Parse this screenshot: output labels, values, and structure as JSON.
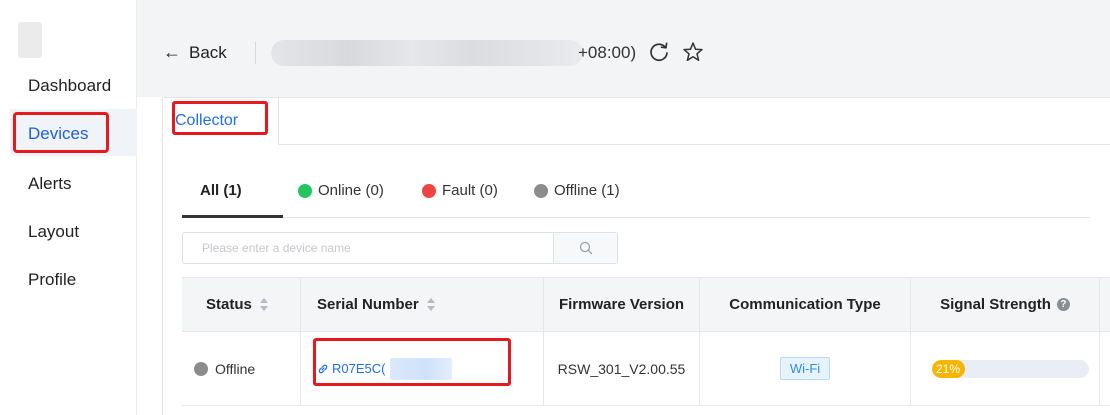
{
  "sidebar": {
    "items": [
      {
        "label": "Dashboard"
      },
      {
        "label": "Devices"
      },
      {
        "label": "Alerts"
      },
      {
        "label": "Layout"
      },
      {
        "label": "Profile"
      }
    ],
    "active": "Devices"
  },
  "header": {
    "back_label": "Back",
    "title_suffix": "+08:00)"
  },
  "tabs": [
    {
      "label": "Collector"
    }
  ],
  "filters": {
    "all": "All (1)",
    "online": "Online (0)",
    "fault": "Fault (0)",
    "offline": "Offline (1)"
  },
  "search": {
    "placeholder": "Please enter a device name"
  },
  "table": {
    "columns": [
      "Status",
      "Serial Number",
      "Firmware Version",
      "Communication Type",
      "Signal Strength"
    ],
    "rows": [
      {
        "status": "Offline",
        "serial": "R07E5C(",
        "firmware": "RSW_301_V2.00.55",
        "comm_type": "Wi-Fi",
        "signal_label": "21%",
        "signal_value": 0.21
      }
    ]
  },
  "colors": {
    "accent": "#1f6fe5",
    "online": "#22c55e",
    "fault": "#ef4444",
    "offline": "#8c8c8c",
    "highlight": "#e8191e",
    "signal": "#f7b500"
  },
  "icons": [
    "back-arrow-icon",
    "refresh-icon",
    "star-icon",
    "search-icon",
    "link-icon",
    "help-icon",
    "sort-icon"
  ]
}
